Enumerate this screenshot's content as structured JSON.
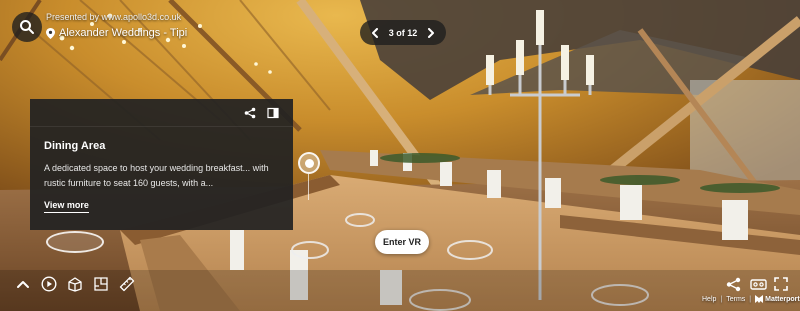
{
  "header": {
    "presenter": "Presented by www.apollo3d.co.uk",
    "space_title": "Alexander Weddings - Tipi"
  },
  "pager": {
    "counter": "3 of 12"
  },
  "tag_card": {
    "title": "Dining Area",
    "description": "A dedicated space to host your wedding breakfast... with rustic furniture to seat 160 guests, with a...",
    "view_more_label": "View more"
  },
  "enter_vr_label": "Enter VR",
  "footer": {
    "help_label": "Help",
    "terms_label": "Terms",
    "brand_label": "Matterport"
  },
  "icons": {
    "search": "search-icon",
    "location": "location-pin-icon",
    "prev": "chevron-left-icon",
    "next": "chevron-right-icon",
    "share": "share-icon",
    "collapse": "panel-collapse-icon",
    "collapse_ui": "chevron-up-icon",
    "play": "play-icon",
    "dollhouse": "dollhouse-icon",
    "floorplan": "floorplan-icon",
    "measure": "ruler-icon",
    "vr": "vr-headset-icon",
    "fullscreen": "fullscreen-icon",
    "brand": "matterport-logo-icon"
  }
}
